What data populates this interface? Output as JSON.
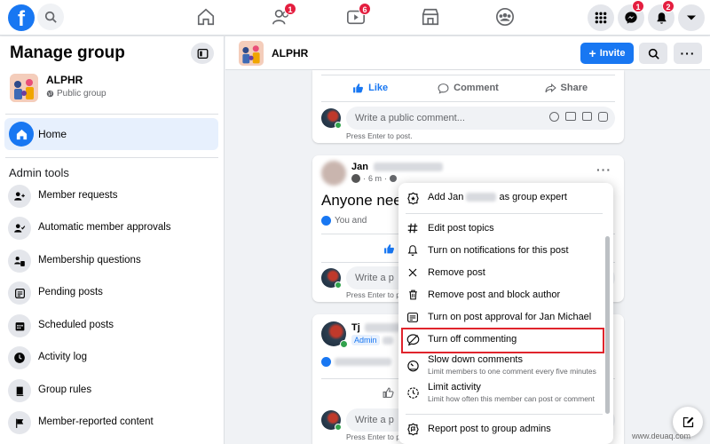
{
  "topbar": {
    "logo_letter": "f",
    "nav": {
      "friends_badge": "1",
      "watch_badge": "6"
    },
    "messenger_badge": "1",
    "notifications_badge": "2"
  },
  "sidebar": {
    "title": "Manage group",
    "group_name": "ALPHR",
    "group_privacy": "Public group",
    "home_label": "Home",
    "admin_tools_label": "Admin tools",
    "items": [
      {
        "label": "Member requests",
        "icon": "member-requests-icon"
      },
      {
        "label": "Automatic member approvals",
        "icon": "auto-approval-icon"
      },
      {
        "label": "Membership questions",
        "icon": "membership-questions-icon"
      },
      {
        "label": "Pending posts",
        "icon": "pending-posts-icon"
      },
      {
        "label": "Scheduled posts",
        "icon": "calendar-icon"
      },
      {
        "label": "Activity log",
        "icon": "clock-icon"
      },
      {
        "label": "Group rules",
        "icon": "rules-book-icon"
      },
      {
        "label": "Member-reported content",
        "icon": "flag-icon"
      }
    ]
  },
  "group_header": {
    "name": "ALPHR",
    "invite_label": "Invite"
  },
  "feed": {
    "like_label": "Like",
    "comment_label": "Comment",
    "share_label": "Share",
    "comment_placeholder": "Write a public comment...",
    "comment_placeholder_short": "Write a p",
    "press_enter": "Press Enter to post.",
    "press_enter_short": "Press Enter to p",
    "post2": {
      "author_first": "Jan",
      "time": "6 m",
      "text_start": "Anyone nee",
      "reactions_start": "You and"
    },
    "post3": {
      "author_first": "Tj",
      "admin_badge": "Admin"
    }
  },
  "menu": {
    "items": [
      {
        "label_pre": "Add Jan",
        "label_post": "as group expert",
        "icon": "expert-badge-icon"
      },
      {
        "label": "Edit post topics",
        "icon": "hashtag-icon"
      },
      {
        "label": "Turn on notifications for this post",
        "icon": "bell-icon"
      },
      {
        "label": "Remove post",
        "icon": "x-icon"
      },
      {
        "label": "Remove post and block author",
        "icon": "trash-icon"
      },
      {
        "label": "Turn on post approval for Jan Michael",
        "icon": "approval-icon"
      },
      {
        "label": "Turn off commenting",
        "icon": "comment-off-icon"
      },
      {
        "label": "Slow down comments",
        "sub": "Limit members to one comment every five minutes",
        "icon": "slow-down-icon"
      },
      {
        "label": "Limit activity",
        "sub": "Limit how often this member can post or comment",
        "icon": "limit-activity-icon"
      },
      {
        "label": "Report post to group admins",
        "icon": "report-icon"
      }
    ]
  },
  "watermark": "www.deuaq.com",
  "colors": {
    "brand": "#1877f2",
    "badge": "#e41e3f",
    "highlight": "#e0242c"
  }
}
